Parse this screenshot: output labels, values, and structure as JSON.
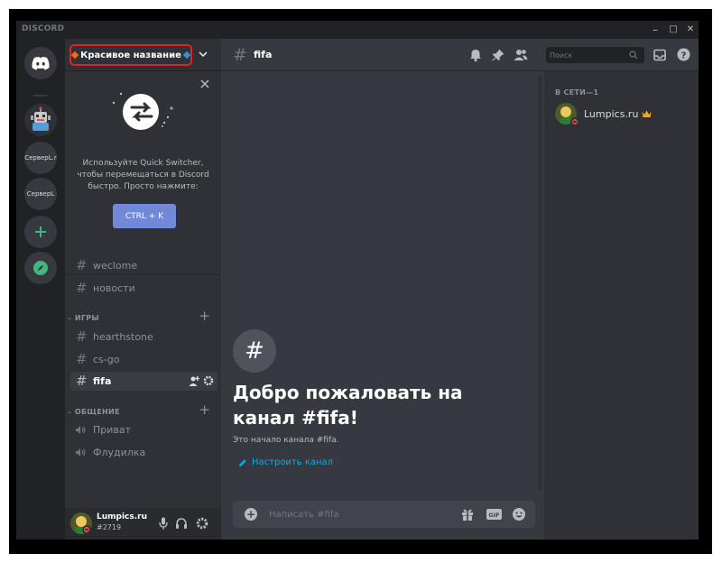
{
  "app": {
    "brand": "DISCORD"
  },
  "window_controls": {
    "minimize": "–",
    "maximize": "□",
    "close": "✕"
  },
  "servers": [
    {
      "kind": "home",
      "icon": "discord-logo-icon"
    },
    {
      "kind": "bot-avatar",
      "icon": "robot-icon"
    },
    {
      "kind": "text",
      "label": "СерверL.r"
    },
    {
      "kind": "text",
      "label": "СерверL"
    },
    {
      "kind": "action",
      "icon": "plus-icon"
    },
    {
      "kind": "action",
      "icon": "compass-icon"
    }
  ],
  "guild": {
    "name": "Красивое название",
    "accent_left": "#f36b1c",
    "accent_right": "#3d8be0",
    "highlight_color": "#e02424"
  },
  "quick_switcher": {
    "text": "Используйте Quick Switcher, чтобы перемещаться в Discord быстро. Просто нажмите:",
    "button": "CTRL + K"
  },
  "channels": {
    "top": [
      {
        "name": "weclome"
      },
      {
        "name": "новости"
      }
    ],
    "categories": [
      {
        "name": "ИГРЫ",
        "channels": [
          {
            "name": "hearthstone",
            "type": "text"
          },
          {
            "name": "cs-go",
            "type": "text"
          },
          {
            "name": "fifa",
            "type": "text",
            "active": true
          }
        ]
      },
      {
        "name": "ОБЩЕНИЕ",
        "channels": [
          {
            "name": "Приват",
            "type": "voice"
          },
          {
            "name": "Флудилка",
            "type": "voice"
          }
        ]
      }
    ]
  },
  "user": {
    "name": "Lumpics.ru",
    "tag": "#2719"
  },
  "chat": {
    "channel": "fifa",
    "welcome_title": "Добро пожаловать на канал #fifa!",
    "welcome_sub": "Это начало канала #fifa.",
    "edit_channel": "Настроить канал",
    "placeholder": "Написать #fifa"
  },
  "members": {
    "search_placeholder": "Поиск",
    "group_title": "В СЕТИ—1",
    "list": [
      {
        "name": "Lumpics.ru",
        "crown": true,
        "status": "dnd"
      }
    ]
  },
  "colors": {
    "blurple": "#7289da",
    "link": "#00b0f4",
    "green": "#43b581",
    "crown": "#faa61a",
    "dnd": "#f04747"
  }
}
